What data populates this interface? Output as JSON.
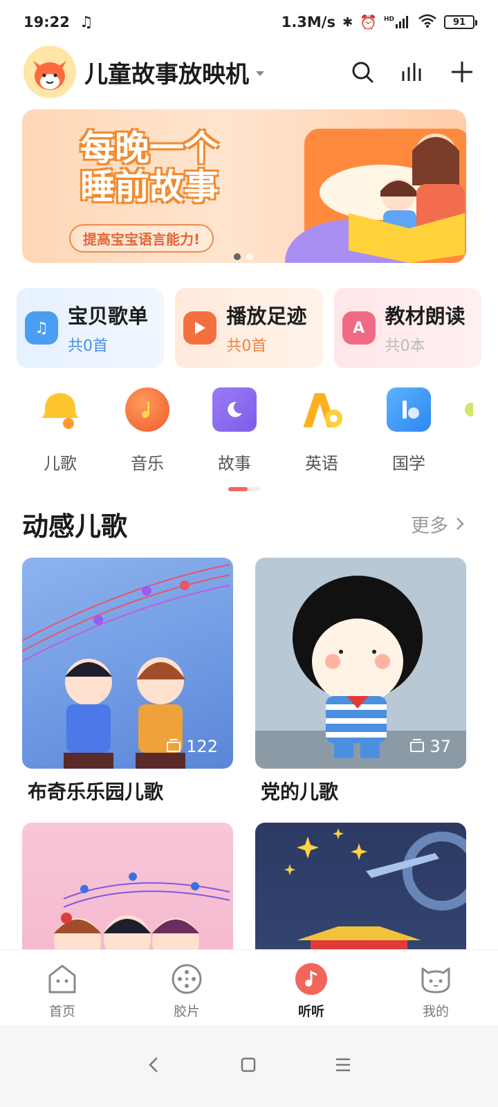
{
  "status_bar": {
    "time": "19:22",
    "speed": "1.3M/s",
    "network_badge": "HD",
    "battery": "91"
  },
  "header": {
    "title": "儿童故事放映机"
  },
  "banner": {
    "title_line1": "每晚一个",
    "title_line2": "睡前故事",
    "subtitle": "提高宝宝语言能力!"
  },
  "quick_cards": [
    {
      "title": "宝贝歌单",
      "subtitle": "共0首",
      "color": "#4a9df3"
    },
    {
      "title": "播放足迹",
      "subtitle": "共0首",
      "color": "#f46f40"
    },
    {
      "title": "教材朗读",
      "subtitle": "共0本",
      "color": "#f06a86"
    }
  ],
  "categories": [
    {
      "label": "儿歌",
      "icon": "bell-icon"
    },
    {
      "label": "音乐",
      "icon": "music-note-icon"
    },
    {
      "label": "故事",
      "icon": "moon-book-icon"
    },
    {
      "label": "英语",
      "icon": "letter-a-icon"
    },
    {
      "label": "国学",
      "icon": "scroll-icon"
    }
  ],
  "section": {
    "title": "动感儿歌",
    "more": "更多"
  },
  "albums": [
    {
      "name": "布奇乐乐园儿歌",
      "count": "122"
    },
    {
      "name": "党的儿歌",
      "count": "37"
    },
    {
      "name": "",
      "count": ""
    },
    {
      "name": "",
      "count": ""
    }
  ],
  "bottom_nav": [
    {
      "label": "首页"
    },
    {
      "label": "胶片"
    },
    {
      "label": "听听"
    },
    {
      "label": "我的"
    }
  ],
  "colors": {
    "accent": "#f2655b",
    "text": "#1d1d1d",
    "muted": "#9a9a9a"
  }
}
